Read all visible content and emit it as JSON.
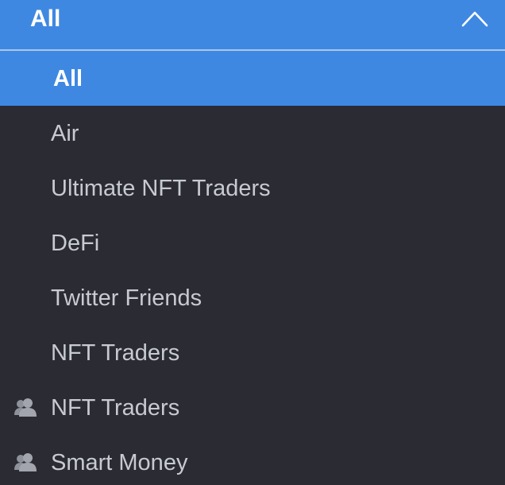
{
  "header": {
    "selected_label": "All",
    "chevron_icon": "chevron-up-icon"
  },
  "items": [
    {
      "label": "All",
      "selected": true,
      "icon": null
    },
    {
      "label": "Air",
      "selected": false,
      "icon": null
    },
    {
      "label": "Ultimate NFT Traders",
      "selected": false,
      "icon": null
    },
    {
      "label": "DeFi",
      "selected": false,
      "icon": null
    },
    {
      "label": "Twitter Friends",
      "selected": false,
      "icon": null
    },
    {
      "label": "NFT Traders",
      "selected": false,
      "icon": null
    },
    {
      "label": "NFT Traders",
      "selected": false,
      "icon": "group-icon"
    },
    {
      "label": "Smart Money",
      "selected": false,
      "icon": "group-icon"
    }
  ],
  "colors": {
    "accent": "#3f88e2",
    "background": "#2a2b33",
    "text": "#c8cad2",
    "icon": "#9a9ca6"
  }
}
